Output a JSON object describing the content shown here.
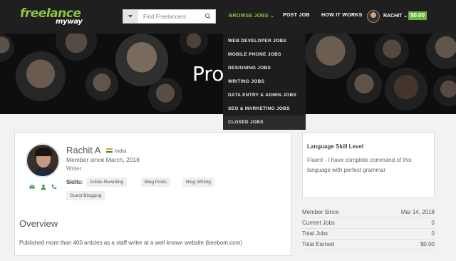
{
  "brand": {
    "line1": "freelance",
    "line2": "myway"
  },
  "search": {
    "placeholder": "Find Freelancers",
    "icon": "search-icon"
  },
  "nav": {
    "browse_jobs": "BROWSE JOBS",
    "browse_caret": "⌄",
    "post_job": "POST JOB",
    "how_it_works": "HOW IT WORKS",
    "user_name": "RACHIT",
    "user_caret": "⌄",
    "balance": "$0.00"
  },
  "hero": {
    "title": "Pro"
  },
  "dropdown": {
    "items": [
      "WEB DEVELOPER JOBS",
      "MOBILE PHONE JOBS",
      "DESIGNING JOBS",
      "WRITING JOBS",
      "DATA ENTRY & ADMIN JOBS",
      "SEO & MARKETING JOBS",
      "CLOSED JOBS"
    ]
  },
  "profile": {
    "name": "Rachit A",
    "country": "India",
    "member_since": "Member since March, 2018",
    "role": "Writer",
    "skills_label": "Skills:",
    "skills": [
      "Article Rewriting",
      "Blog Posts",
      "Blog Writing",
      "Guest Blogging"
    ]
  },
  "overview": {
    "title": "Overview",
    "text": "Published more than 400 articles as a staff writer at a well known website (beebom.com)"
  },
  "language": {
    "title": "Language Skill Level",
    "text": "Fluent - I have complete command of this language with perfect grammar"
  },
  "stats": [
    {
      "label": "Member Since",
      "value": "Mar 14, 2018"
    },
    {
      "label": "Current Jobs",
      "value": "0"
    },
    {
      "label": "Total Jobs",
      "value": "0"
    },
    {
      "label": "Total Earned",
      "value": "$0.00"
    }
  ],
  "colors": {
    "accent": "#8dc63f",
    "balance_bg": "#6cb33f",
    "nav_bg": "#1f1f1f",
    "dropdown_bg": "#1d1d1d"
  }
}
